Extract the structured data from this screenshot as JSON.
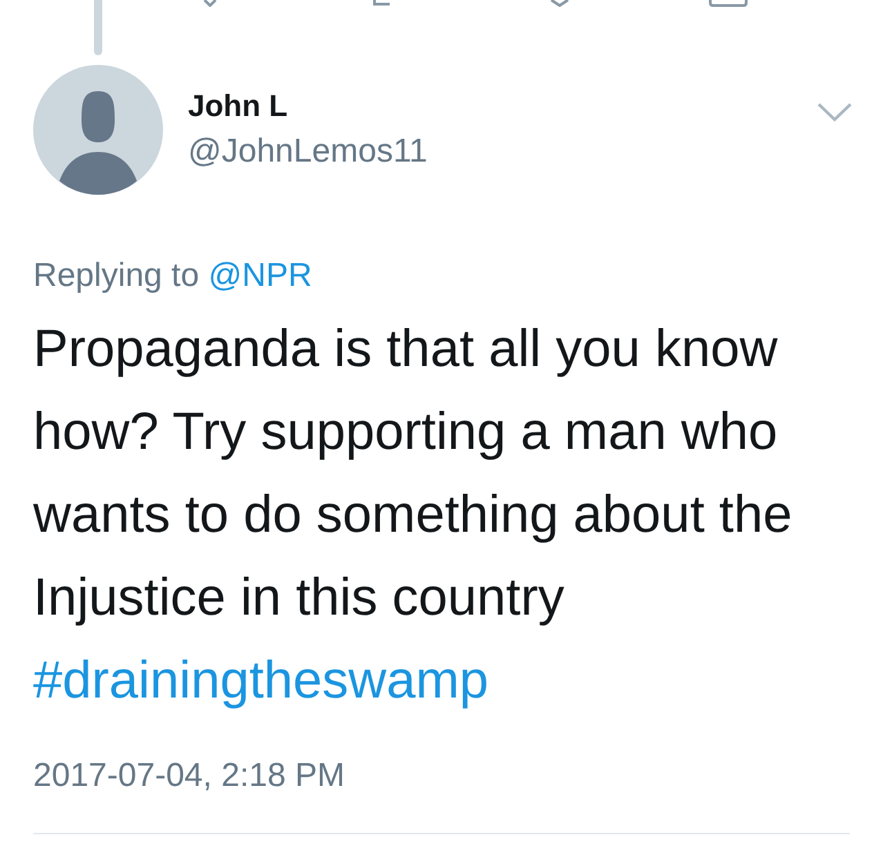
{
  "tweet": {
    "author": {
      "name": "John L",
      "handle": "@JohnLemos11"
    },
    "reply_context": {
      "label": "Replying to",
      "mention": "@NPR"
    },
    "text": "Propaganda is that all you know how? Try supporting a man who wants to do something about the Injustice in this country",
    "hashtag": "#drainingtheswamp",
    "timestamp": "2017-07-04, 2:18 PM"
  }
}
